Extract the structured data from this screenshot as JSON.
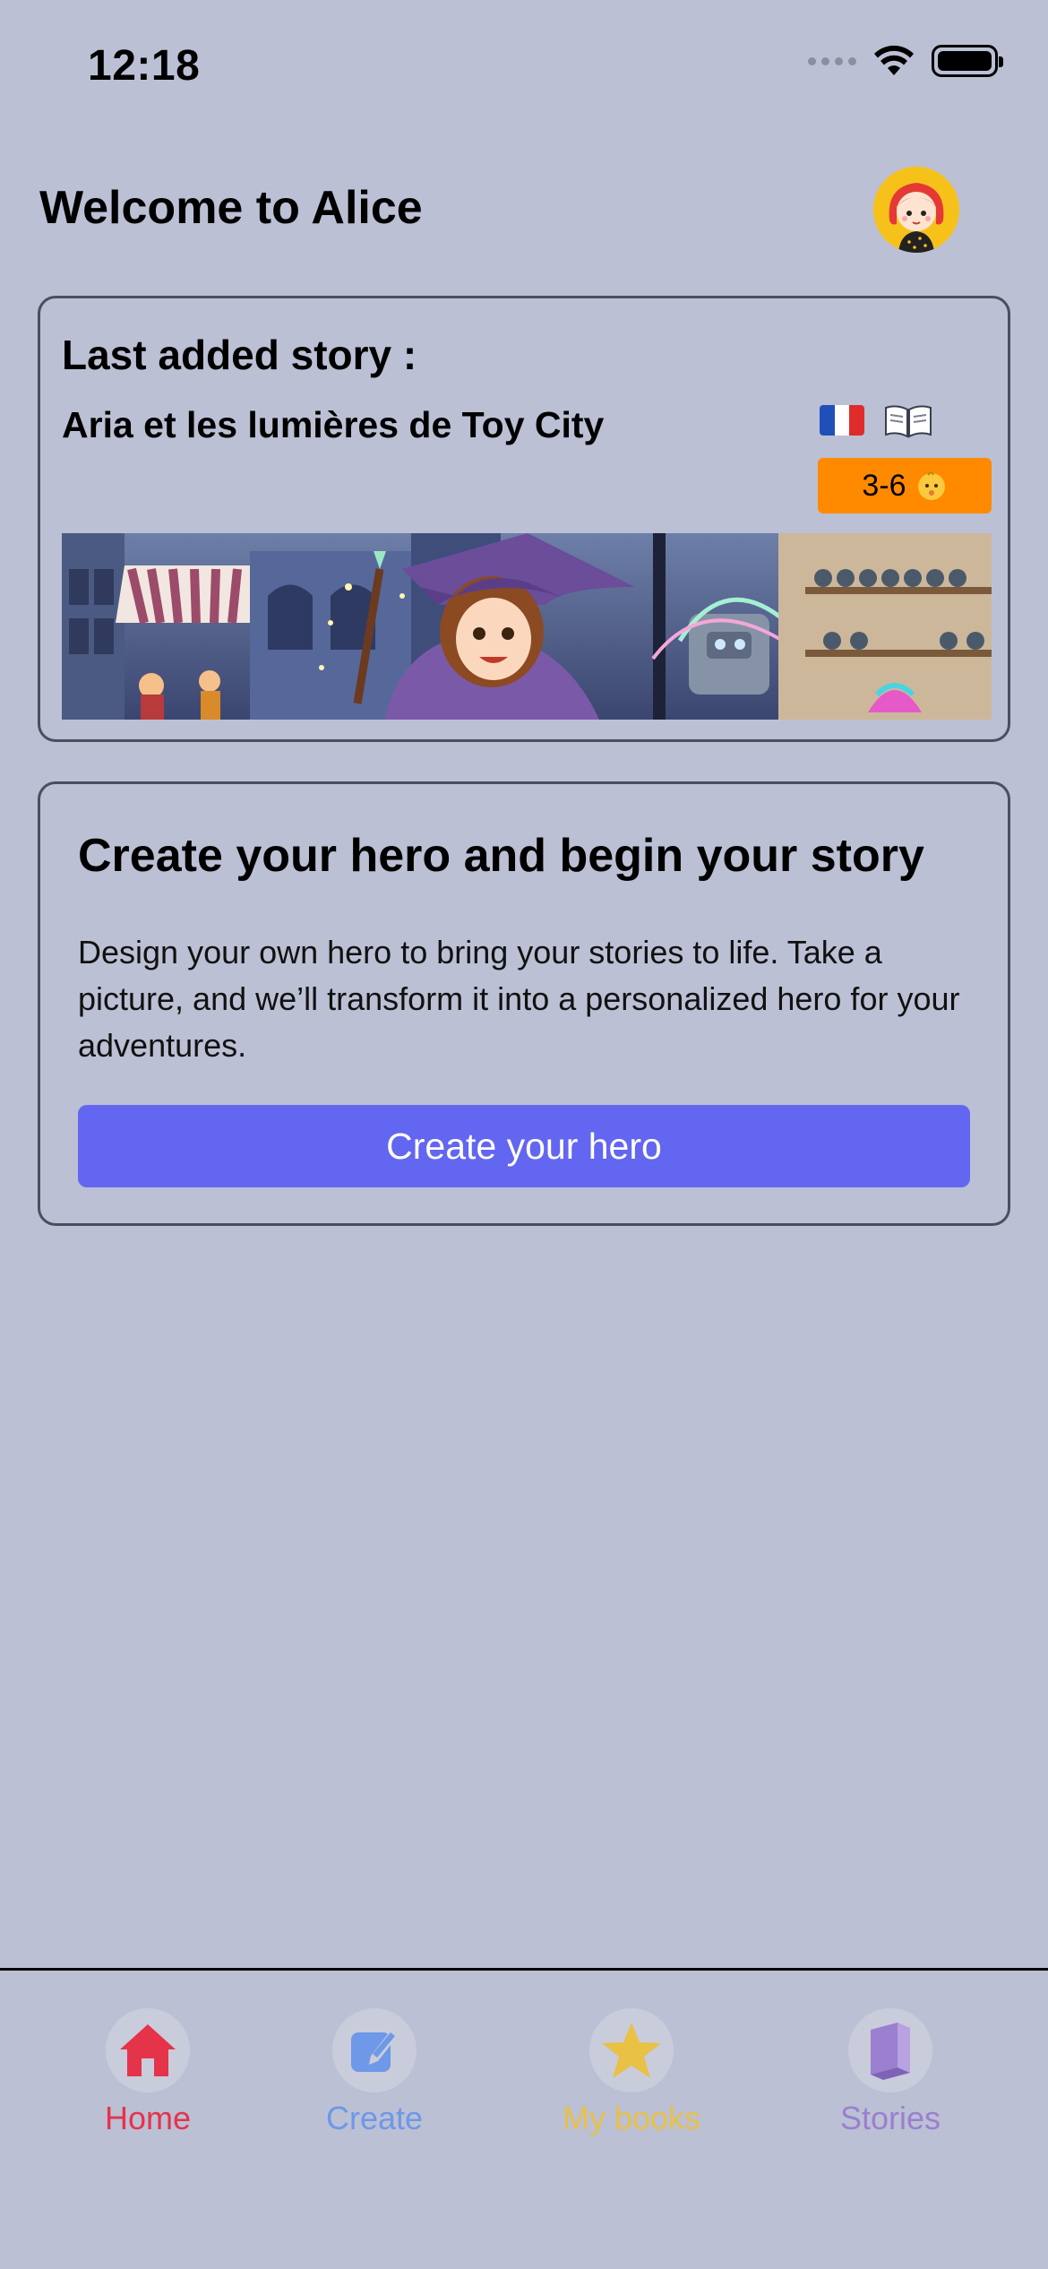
{
  "status_bar": {
    "time": "12:18"
  },
  "header": {
    "welcome": "Welcome to Alice",
    "avatar_icon": "girl-avatar-icon"
  },
  "last_story": {
    "heading": "Last added story :",
    "title": "Aria et les lumières de Toy City",
    "language_icon": "french-flag-icon",
    "type_icon": "open-book-icon",
    "age_range": "3-6",
    "age_icon": "baby-face-icon",
    "badge_color": "#ff8a00"
  },
  "hero_card": {
    "title": "Create your hero and begin your story",
    "description": "Design your own hero to bring your stories to life. Take a picture, and we’ll transform it into a personalized hero for your adventures.",
    "button_label": "Create your hero",
    "button_color": "#6366f1"
  },
  "tabs": [
    {
      "label": "Home",
      "icon": "house-icon",
      "color": "#e5334a",
      "active": true
    },
    {
      "label": "Create",
      "icon": "pencil-square-icon",
      "color": "#6e98e8",
      "active": false
    },
    {
      "label": "My books",
      "icon": "star-icon",
      "color": "#e8c145",
      "active": false
    },
    {
      "label": "Stories",
      "icon": "book-icon",
      "color": "#9b7fd0",
      "active": false
    }
  ],
  "colors": {
    "background": "#bbc0d4",
    "card_border": "#4a4f5f"
  }
}
